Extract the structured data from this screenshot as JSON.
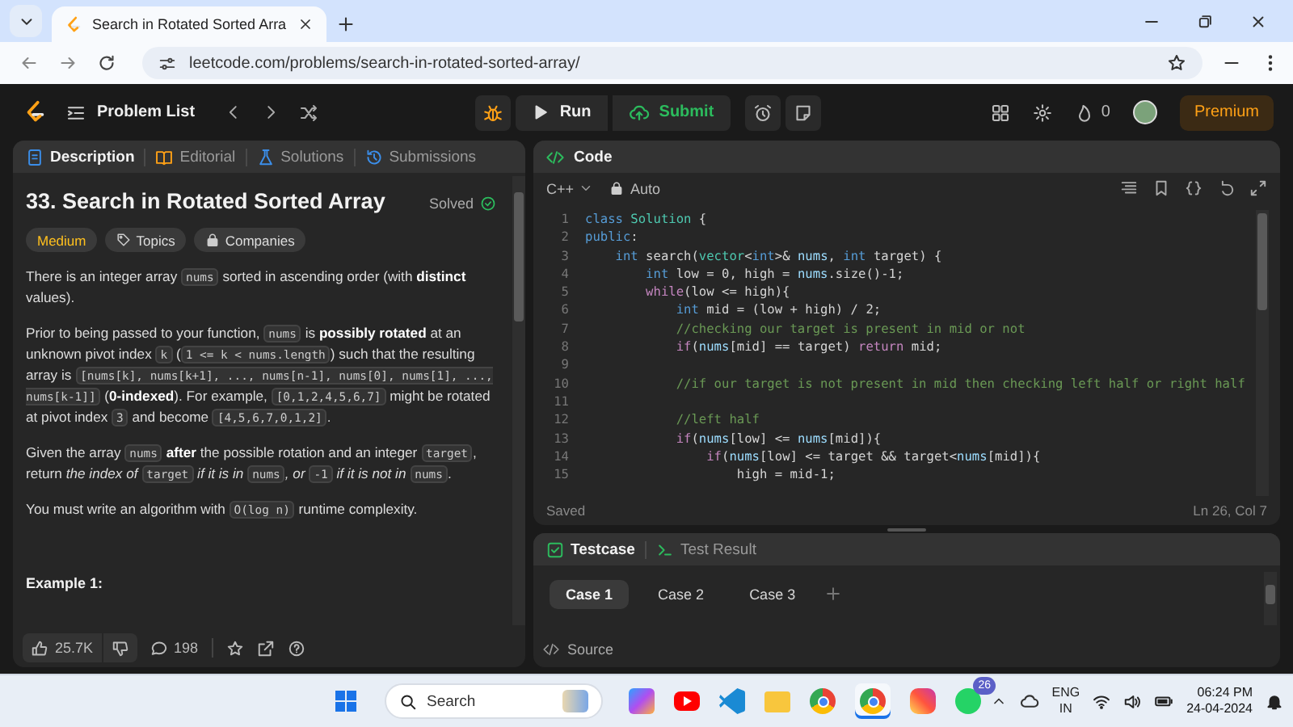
{
  "browser": {
    "tab_title": "Search in Rotated Sorted Arra",
    "url": "leetcode.com/problems/search-in-rotated-sorted-array/"
  },
  "header": {
    "problem_list": "Problem List",
    "run": "Run",
    "submit": "Submit",
    "streak": "0",
    "premium": "Premium"
  },
  "description_panel": {
    "tabs": [
      {
        "label": "Description",
        "kind": "description",
        "selected": true
      },
      {
        "label": "Editorial",
        "kind": "editorial",
        "selected": false
      },
      {
        "label": "Solutions",
        "kind": "solutions",
        "selected": false
      },
      {
        "label": "Submissions",
        "kind": "submissions",
        "selected": false
      }
    ],
    "title": "33. Search in Rotated Sorted Array",
    "status": "Solved",
    "tags": [
      {
        "kind": "difficulty",
        "label": "Medium"
      },
      {
        "kind": "topics",
        "label": "Topics"
      },
      {
        "kind": "companies",
        "label": "Companies"
      }
    ],
    "paragraphs": [
      [
        {
          "kind": "text",
          "text": "There is an integer array "
        },
        {
          "kind": "code",
          "text": "nums"
        },
        {
          "kind": "text",
          "text": " sorted in ascending order (with **distinct** values)."
        }
      ],
      [
        {
          "kind": "text",
          "text": "Prior to being passed to your function, "
        },
        {
          "kind": "code",
          "text": "nums"
        },
        {
          "kind": "text",
          "text": " is **possibly rotated** at an unknown pivot index "
        },
        {
          "kind": "code",
          "text": "k"
        },
        {
          "kind": "text",
          "text": " ("
        },
        {
          "kind": "code",
          "text": "1 <= k < nums.length"
        },
        {
          "kind": "text",
          "text": ") such that the resulting array is "
        },
        {
          "kind": "code",
          "text": "[nums[k], nums[k+1], ..., nums[n-1], nums[0], nums[1], ..., nums[k-1]]"
        },
        {
          "kind": "text",
          "text": " (**0-indexed**). For example, "
        },
        {
          "kind": "code",
          "text": "[0,1,2,4,5,6,7]"
        },
        {
          "kind": "text",
          "text": " might be rotated at pivot index "
        },
        {
          "kind": "code",
          "text": "3"
        },
        {
          "kind": "text",
          "text": " and become "
        },
        {
          "kind": "code",
          "text": "[4,5,6,7,0,1,2]"
        },
        {
          "kind": "text",
          "text": "."
        }
      ],
      [
        {
          "kind": "text",
          "text": "Given the array "
        },
        {
          "kind": "code",
          "text": "nums"
        },
        {
          "kind": "text",
          "text": " **after** the possible rotation and an integer "
        },
        {
          "kind": "code",
          "text": "target"
        },
        {
          "kind": "text",
          "text": ", return *the index of* "
        },
        {
          "kind": "code",
          "text": "target"
        },
        {
          "kind": "text",
          "text": " *if it is in* "
        },
        {
          "kind": "code",
          "text": "nums"
        },
        {
          "kind": "text",
          "text": "*, or* "
        },
        {
          "kind": "code",
          "text": "-1"
        },
        {
          "kind": "text",
          "text": " *if it is not in* "
        },
        {
          "kind": "code",
          "text": "nums"
        },
        {
          "kind": "text",
          "text": "."
        }
      ],
      [
        {
          "kind": "text",
          "text": "You must write an algorithm with "
        },
        {
          "kind": "code",
          "text": "O(log n)"
        },
        {
          "kind": "text",
          "text": " runtime complexity."
        }
      ]
    ],
    "example_heading": "Example 1:",
    "footer": {
      "likes": "25.7K",
      "comments": "198"
    }
  },
  "code_panel": {
    "title": "Code",
    "language": "C++",
    "mode": "Auto",
    "lines": [
      {
        "number": "1",
        "tokens": [
          {
            "kind": "kw",
            "text": "class "
          },
          {
            "kind": "type",
            "text": "Solution"
          },
          {
            "kind": "txt",
            "text": " {"
          }
        ]
      },
      {
        "number": "2",
        "tokens": [
          {
            "kind": "kw",
            "text": "public"
          },
          {
            "kind": "txt",
            "text": ":"
          }
        ]
      },
      {
        "number": "3",
        "tokens": [
          {
            "kind": "kw",
            "text": "    int"
          },
          {
            "kind": "txt",
            "text": " search("
          },
          {
            "kind": "type",
            "text": "vector"
          },
          {
            "kind": "txt",
            "text": "<"
          },
          {
            "kind": "kw",
            "text": "int"
          },
          {
            "kind": "txt",
            "text": ">& "
          },
          {
            "kind": "var",
            "text": "nums"
          },
          {
            "kind": "txt",
            "text": ", "
          },
          {
            "kind": "kw",
            "text": "int"
          },
          {
            "kind": "txt",
            "text": " target) {"
          }
        ]
      },
      {
        "number": "4",
        "tokens": [
          {
            "kind": "kw",
            "text": "        int"
          },
          {
            "kind": "txt",
            "text": " low = 0, high = "
          },
          {
            "kind": "var",
            "text": "nums"
          },
          {
            "kind": "txt",
            "text": ".size()-1;"
          }
        ]
      },
      {
        "number": "5",
        "tokens": [
          {
            "kind": "ctl",
            "text": "        while"
          },
          {
            "kind": "txt",
            "text": "(low <= high){"
          }
        ]
      },
      {
        "number": "6",
        "tokens": [
          {
            "kind": "kw",
            "text": "            int"
          },
          {
            "kind": "txt",
            "text": " mid = (low + high) / 2;"
          }
        ]
      },
      {
        "number": "7",
        "tokens": [
          {
            "kind": "com",
            "text": "            //checking our target is present in mid or not"
          }
        ]
      },
      {
        "number": "8",
        "tokens": [
          {
            "kind": "ctl",
            "text": "            if"
          },
          {
            "kind": "txt",
            "text": "("
          },
          {
            "kind": "var",
            "text": "nums"
          },
          {
            "kind": "txt",
            "text": "[mid] == target) "
          },
          {
            "kind": "ctl",
            "text": "return"
          },
          {
            "kind": "txt",
            "text": " mid;"
          }
        ]
      },
      {
        "number": "9"
      },
      {
        "number": "10",
        "tokens": [
          {
            "kind": "com",
            "text": "            //if our target is not present in mid then checking left half or right half"
          }
        ]
      },
      {
        "number": "11"
      },
      {
        "number": "12",
        "tokens": [
          {
            "kind": "com",
            "text": "            //left half"
          }
        ]
      },
      {
        "number": "13",
        "tokens": [
          {
            "kind": "ctl",
            "text": "            if"
          },
          {
            "kind": "txt",
            "text": "("
          },
          {
            "kind": "var",
            "text": "nums"
          },
          {
            "kind": "txt",
            "text": "[low] <= "
          },
          {
            "kind": "var",
            "text": "nums"
          },
          {
            "kind": "txt",
            "text": "[mid]){"
          }
        ]
      },
      {
        "number": "14",
        "tokens": [
          {
            "kind": "ctl",
            "text": "                if"
          },
          {
            "kind": "txt",
            "text": "("
          },
          {
            "kind": "var",
            "text": "nums"
          },
          {
            "kind": "txt",
            "text": "[low] <= target && target<"
          },
          {
            "kind": "var",
            "text": "nums"
          },
          {
            "kind": "txt",
            "text": "[mid]){"
          }
        ]
      },
      {
        "number": "15",
        "tokens": [
          {
            "kind": "txt",
            "text": "                    high = mid-1;"
          }
        ]
      }
    ],
    "status": "Saved",
    "cursor": "Ln 26, Col 7"
  },
  "test_panel": {
    "tabs": [
      {
        "label": "Testcase",
        "kind": "testcase",
        "selected": true
      },
      {
        "label": "Test Result",
        "kind": "result",
        "selected": false
      }
    ],
    "cases": [
      {
        "label": "Case 1",
        "selected": true
      },
      {
        "label": "Case 2",
        "selected": false
      },
      {
        "label": "Case 3",
        "selected": false
      }
    ],
    "source": "Source"
  },
  "taskbar": {
    "search_placeholder": "Search",
    "chat_badge": "26",
    "language": "ENG",
    "region": "IN",
    "time": "06:24 PM",
    "date": "24-04-2024"
  }
}
